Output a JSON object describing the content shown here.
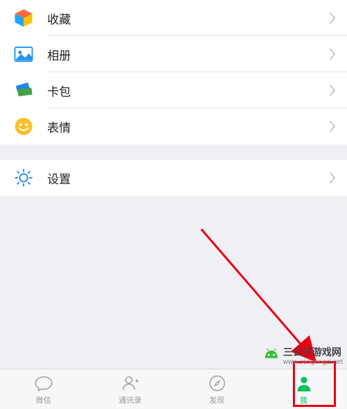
{
  "menu": {
    "favorites": "收藏",
    "album": "相册",
    "cards": "卡包",
    "stickers": "表情",
    "settings": "设置"
  },
  "tabs": {
    "chats": "微信",
    "contacts": "通讯录",
    "discover": "发现",
    "me": "我"
  },
  "watermark": {
    "title": "三公子游戏网",
    "url": "www.sangongzi.net"
  }
}
